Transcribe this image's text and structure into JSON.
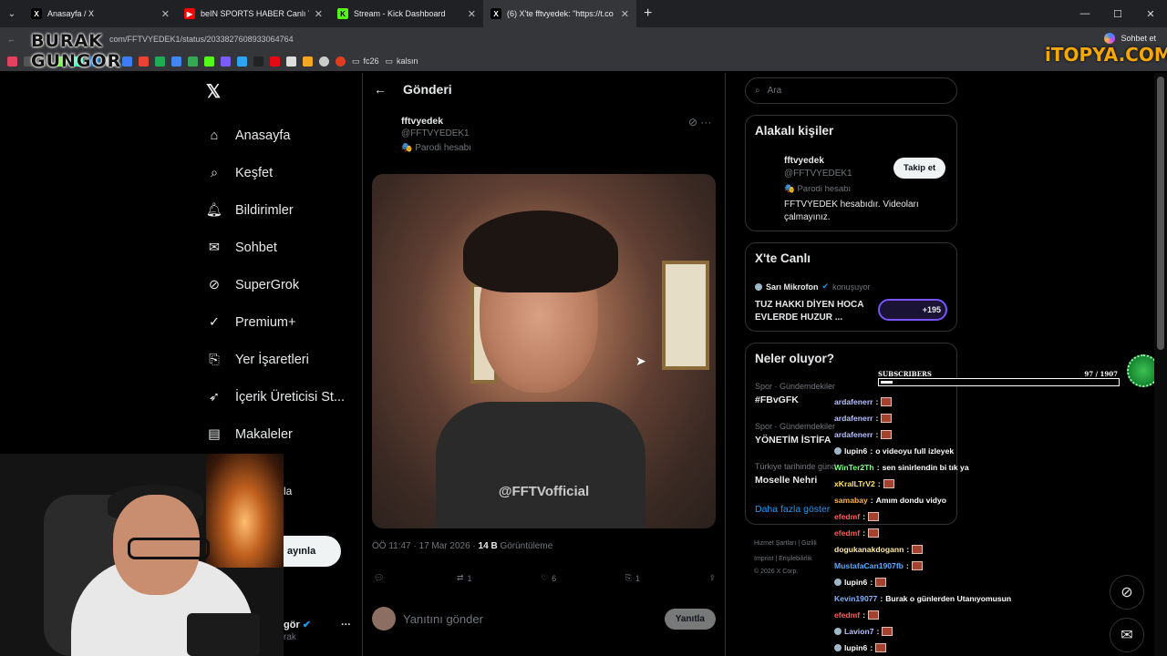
{
  "browser": {
    "tabs": [
      {
        "label": "Anasayfa / X",
        "fav": "X",
        "favbg": "#000",
        "favfg": "#fff"
      },
      {
        "label": "beIN SPORTS HABER Canlı Yayını |",
        "fav": "▶",
        "favbg": "#ff0000",
        "favfg": "#fff"
      },
      {
        "label": "Stream - Kick Dashboard",
        "fav": "K",
        "favbg": "#53fc18",
        "favfg": "#000"
      },
      {
        "label": "(6) X'te fftvyedek: \"https://t.co",
        "fav": "X",
        "favbg": "#000",
        "favfg": "#fff"
      }
    ],
    "url": "com/FFTVYEDEK1/status/2033827608933064764",
    "bookmarks": [
      "fc26",
      "kalsın"
    ],
    "profile_button": "Sohbet et"
  },
  "overlay": {
    "streamer_logo_line1": "BURAK",
    "streamer_logo_line2": "GUNGOR",
    "sponsor": "iTOPYA.COM",
    "subscribers_label": "SUBSCRIBERS",
    "subscribers_current": "97",
    "subscribers_sep": "/",
    "subscribers_goal": "1907",
    "subscribers_progress": 0.05
  },
  "nav": {
    "items": [
      {
        "label": "Anasayfa",
        "icon": "home-icon"
      },
      {
        "label": "Keşfet",
        "icon": "search-icon"
      },
      {
        "label": "Bildirimler",
        "icon": "bell-icon"
      },
      {
        "label": "Sohbet",
        "icon": "mail-icon"
      },
      {
        "label": "SuperGrok",
        "icon": "grok-icon"
      },
      {
        "label": "Premium+",
        "icon": "verified-icon"
      },
      {
        "label": "Yer İşaretleri",
        "icon": "bookmark-icon"
      },
      {
        "label": "İçerik Üreticisi St...",
        "icon": "rocket-icon"
      },
      {
        "label": "Makaleler",
        "icon": "article-icon"
      }
    ],
    "partial_more": "la",
    "post_button": "ayınla",
    "account_name": "gör",
    "account_handle": "rak"
  },
  "post": {
    "header": "Gönderi",
    "author_name": "fftvyedek",
    "author_handle": "@FFTVYEDEK1",
    "parody": "Parodi hesabı",
    "watermark": "@FFTVofficial",
    "time": "ÖÖ 11:47 · 17 Mar 2026 ·",
    "views_count": "14 B",
    "views_label": "Görüntüleme",
    "replies": "",
    "reposts": "1",
    "likes": "6",
    "bookmarks": "1",
    "reply_placeholder": "Yanıtını gönder",
    "reply_button": "Yanıtla"
  },
  "sidebar": {
    "search_placeholder": "Ara",
    "related_title": "Alakalı kişiler",
    "related_name": "fftvyedek",
    "related_handle": "@FFTVYEDEK1",
    "related_parody": "Parodi hesabı",
    "related_bio": "FFTVYEDEK hesabıdır. Videoları çalmayınız.",
    "follow_button": "Takip et",
    "live_title": "X'te Canlı",
    "live_host": "Sarı Mikrofon",
    "live_status": "konuşuyor",
    "live_topic": "TUZ HAKKI DİYEN HOCA EVLERDE HUZUR ...",
    "live_count": "+195",
    "trends_title": "Neler oluyor?",
    "trends": [
      {
        "cat": "Spor · Gündemdekiler",
        "name": "#FBvGFK"
      },
      {
        "cat": "Spor · Gündemdekiler",
        "name": "YÖNETİM İSTİFA"
      },
      {
        "cat": "Türkiye tarihinde günd",
        "name": "Moselle Nehri"
      }
    ],
    "show_more": "Daha fazla göster",
    "footer_line1": "Hizmet Şartları | Gizlili",
    "footer_line2": "Imprint | Erişilebilirlik",
    "footer_line3": "© 2026 X Corp."
  },
  "chat": [
    {
      "user": "ardafenerr",
      "color": "#b7c0ff",
      "msg": "",
      "emote": true,
      "badge": false
    },
    {
      "user": "ardafenerr",
      "color": "#b7c0ff",
      "msg": "",
      "emote": true,
      "badge": false
    },
    {
      "user": "ardafenerr",
      "color": "#b7c0ff",
      "msg": "",
      "emote": true,
      "badge": false
    },
    {
      "user": "lupin6",
      "color": "#ffffff",
      "msg": "o videoyu full izleyek",
      "emote": false,
      "badge": true
    },
    {
      "user": "WinTer2Th",
      "color": "#7dff7d",
      "msg": "sen sinirlendin bi tık ya",
      "emote": false,
      "badge": false
    },
    {
      "user": "xKralLTrV2",
      "color": "#ffe36b",
      "msg": "",
      "emote": true,
      "badge": false
    },
    {
      "user": "samabay",
      "color": "#ffb347",
      "msg": "Amım dondu vidyo",
      "emote": false,
      "badge": false
    },
    {
      "user": "efedmf",
      "color": "#ff5e5e",
      "msg": "",
      "emote": true,
      "badge": false
    },
    {
      "user": "efedmf",
      "color": "#ff5e5e",
      "msg": "",
      "emote": true,
      "badge": false
    },
    {
      "user": "dogukanakdogann",
      "color": "#ffe9a8",
      "msg": "",
      "emote": true,
      "badge": false
    },
    {
      "user": "MustafaCan1907fb",
      "color": "#5fa8ff",
      "msg": "",
      "emote": true,
      "badge": false
    },
    {
      "user": "lupin6",
      "color": "#ffffff",
      "msg": "",
      "emote": true,
      "badge": true
    },
    {
      "user": "Kevin19077",
      "color": "#7fb3ff",
      "msg": "Burak o günlerden Utanıyomusun",
      "emote": false,
      "badge": false
    },
    {
      "user": "efedmf",
      "color": "#ff5e5e",
      "msg": "",
      "emote": true,
      "badge": false
    },
    {
      "user": "Lavion7",
      "color": "#b7c0ff",
      "msg": "",
      "emote": true,
      "badge": true
    },
    {
      "user": "lupin6",
      "color": "#ffffff",
      "msg": "",
      "emote": true,
      "badge": true
    }
  ]
}
